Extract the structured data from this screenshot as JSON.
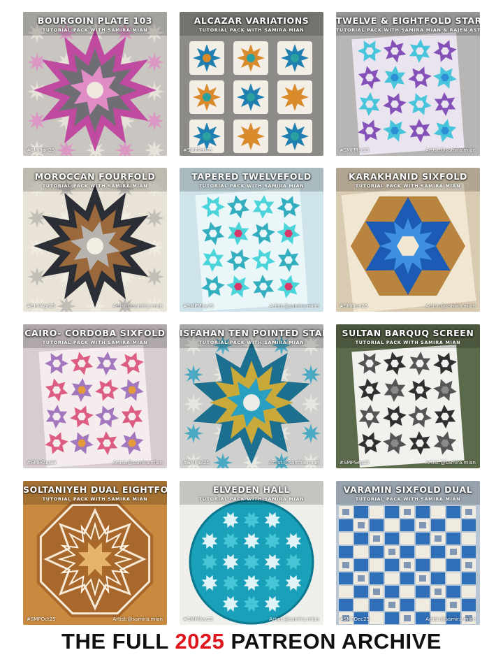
{
  "tiles": [
    {
      "title": "BOURGOIN PLATE 103",
      "subtitle": "TUTORIAL PACK WITH SAMIRA MIAN",
      "tag": "#SMPJan25",
      "artist": "",
      "bg": "#c9c6c2",
      "c1": "#c04a9f",
      "c2": "#6f6e74",
      "c3": "#efe9e0",
      "c4": "#e08cc5",
      "kind": "star"
    },
    {
      "title": "ALCAZAR VARIATIONS",
      "subtitle": "TUTORIAL PACK WITH SAMIRA MIAN",
      "tag": "#SMPFeb25",
      "artist": "",
      "bg": "#8d8b87",
      "c1": "#d98a2b",
      "c2": "#1f7fb0",
      "c3": "#f3efe6",
      "c4": "#2aa0a0",
      "kind": "cards"
    },
    {
      "title": "TWELVE & EIGHTFOLD STARS",
      "subtitle": "TUTORIAL PACK WITH SAMIRA MIAN & RAJEN ASTHO",
      "tag": "#SMPMar25",
      "artist": "Artist:@samira.mian",
      "bg": "#b8b6b4",
      "c1": "#7a3fb0",
      "c2": "#2e8fd6",
      "c3": "#e9e4ee",
      "c4": "#36c0d8",
      "kind": "paper"
    },
    {
      "title": "MOROCCAN FOURFOLD",
      "subtitle": "TUTORIAL PACK WITH SAMIRA MIAN",
      "tag": "#SMPApr25",
      "artist": "Artist:@samira.mian",
      "bg": "#e9e3d7",
      "c1": "#2c2e36",
      "c2": "#9a6a3c",
      "c3": "#f2ede3",
      "c4": "#b7b4b0",
      "kind": "star"
    },
    {
      "title": "TAPERED TWELVEFOLD",
      "subtitle": "TUTORIAL PACK WITH SAMIRA MIAN",
      "tag": "#SMPMay25",
      "artist": "Artist:@samira.mian",
      "bg": "#cfe3ea",
      "c1": "#1fa6b8",
      "c2": "#d83a6a",
      "c3": "#eaf6f8",
      "c4": "#3ad2d6",
      "kind": "paper"
    },
    {
      "title": "KARAKHANID SIXFOLD",
      "subtitle": "TUTORIAL PACK WITH SAMIRA MIAN",
      "tag": "#SMPJun25",
      "artist": "Artist:@samira.mian",
      "bg": "#d9cbb2",
      "c1": "#1c5bb5",
      "c2": "#b8843f",
      "c3": "#f0e6d2",
      "c4": "#3f8fe0",
      "kind": "hex"
    },
    {
      "title": "CAIRO- CORDOBA SIXFOLD",
      "subtitle": "TUTORIAL PACK WITH SAMIRA MIAN",
      "tag": "#SMPAug25",
      "artist": "Artist:@samira.mian",
      "bg": "#d7ccd0",
      "c1": "#d94c78",
      "c2": "#e39a3a",
      "c3": "#f5ecee",
      "c4": "#9a6ab8",
      "kind": "paper"
    },
    {
      "title": "ISFAHAN TEN POINTED STAR",
      "subtitle": "TUTORIAL PACK WITH SAMIRA MIAN",
      "tag": "#SMPJul25",
      "artist": "Artist:@samira.mian",
      "bg": "#cfd0cd",
      "c1": "#1d6f8f",
      "c2": "#c9a93a",
      "c3": "#ecece6",
      "c4": "#2a9fc2",
      "kind": "star"
    },
    {
      "title": "SULTAN BARQUQ SCREEN",
      "subtitle": "TUTORIAL PACK WITH SAMIRA MIAN",
      "tag": "#SMPSep25",
      "artist": "Artist:@samira.mian",
      "bg": "#5c6a4c",
      "c1": "#1b1b1b",
      "c2": "#8a8a8a",
      "c3": "#f1f1ee",
      "c4": "#444444",
      "kind": "paper"
    },
    {
      "title": "SOLTANIYEH DUAL EIGHTFOLD",
      "subtitle": "TUTORIAL PACK WITH SAMIRA MIAN",
      "tag": "#SMPOct25",
      "artist": "Artist:@samira.mian",
      "bg": "#c98a3f",
      "c1": "#f6ead8",
      "c2": "#a8672b",
      "c3": "#e7b46c",
      "c4": "#fff4e4",
      "kind": "octagon"
    },
    {
      "title": "ELVEDEN HALL",
      "subtitle": "TUTORIAL PACK WITH SAMIRA MIAN",
      "tag": "#SMPNov25",
      "artist": "Artist:@samira.mian",
      "bg": "#efefec",
      "c1": "#1aa0b8",
      "c2": "#0b7890",
      "c3": "#dff3f5",
      "c4": "#46c6d6",
      "kind": "circle"
    },
    {
      "title": "VARAMIN SIXFOLD DUAL",
      "subtitle": "TUTORIAL PACK WITH SAMIRA MIAN",
      "tag": "#SMPDec25",
      "artist": "Artist:@samira.mian",
      "bg": "#b9c6d4",
      "c1": "#2f6fb8",
      "c2": "#f0ebe0",
      "c3": "#7f97b4",
      "c4": "#4a90d9",
      "kind": "checker"
    }
  ],
  "footer": {
    "before": "THE FULL ",
    "year": "2025",
    "after": " PATREON ARCHIVE",
    "year_color": "#e0161d"
  }
}
